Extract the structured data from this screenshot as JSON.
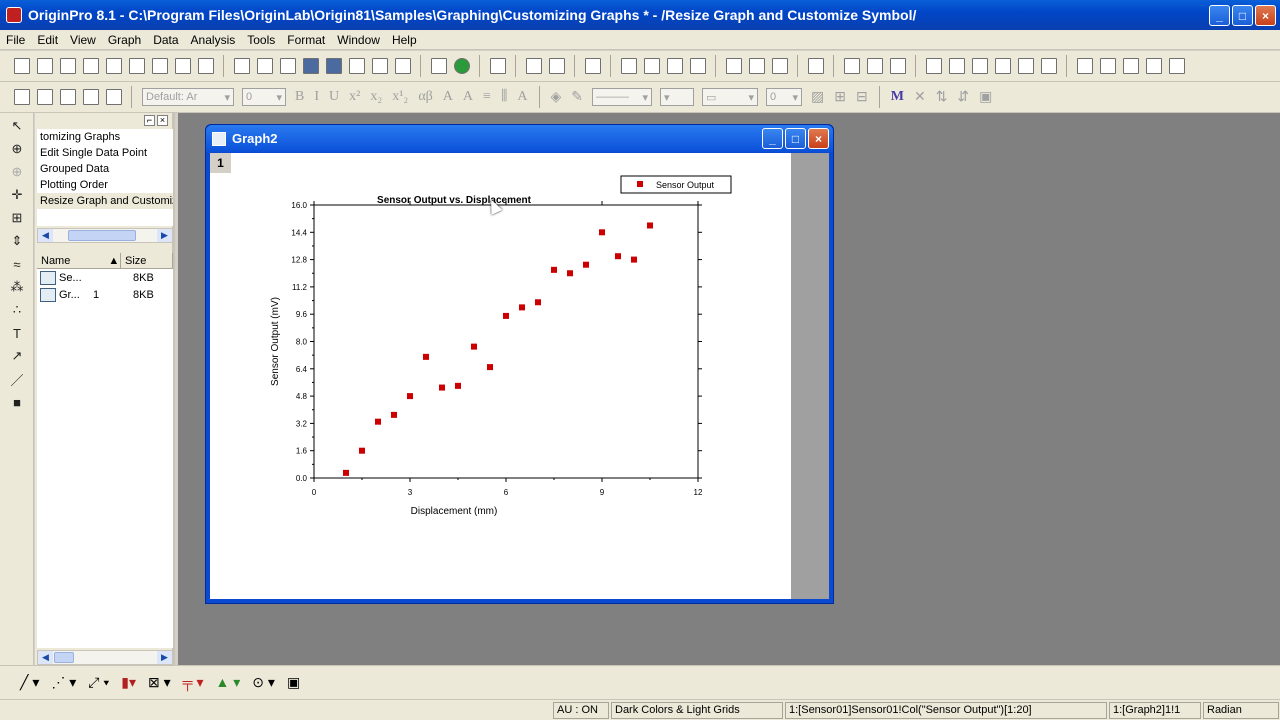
{
  "window": {
    "title": "OriginPro 8.1 - C:\\Program Files\\OriginLab\\Origin81\\Samples\\Graphing\\Customizing Graphs * - /Resize Graph and Customize Symbol/"
  },
  "menu": [
    "File",
    "Edit",
    "View",
    "Graph",
    "Data",
    "Analysis",
    "Tools",
    "Format",
    "Window",
    "Help"
  ],
  "format_toolbar": {
    "font_combo": "Default: Ar",
    "size_combo": "0",
    "extra_combo": "0"
  },
  "explorer": {
    "folders": [
      "tomizing Graphs",
      "Edit Single Data Point",
      "Grouped Data",
      "Plotting Order",
      "Resize Graph and Customiz"
    ],
    "columns": {
      "name": "Name",
      "size": "Size"
    },
    "files": [
      {
        "name": "Se...",
        "extra": "",
        "size": "8KB",
        "icon": "worksheet-icon"
      },
      {
        "name": "Gr...",
        "extra": "1",
        "size": "8KB",
        "icon": "graph-icon"
      }
    ]
  },
  "graph_window": {
    "title": "Graph2",
    "layer": "1"
  },
  "chart_data": {
    "type": "scatter",
    "title": "Sensor Output vs. Displacement",
    "xlabel": "Displacement (mm)",
    "ylabel": "Sensor Output (mV)",
    "xlim": [
      0,
      12
    ],
    "ylim": [
      0,
      16
    ],
    "xticks": [
      "0",
      "3",
      "6",
      "9",
      "12"
    ],
    "yticks": [
      "0.0",
      "1.6",
      "3.2",
      "4.8",
      "6.4",
      "8.0",
      "9.6",
      "11.2",
      "12.8",
      "14.4",
      "16.0"
    ],
    "legend": "Sensor Output",
    "legend_position": "top-right",
    "marker_color": "#cc0000",
    "series": [
      {
        "name": "Sensor Output",
        "x": [
          1.0,
          1.5,
          2.0,
          2.5,
          3.0,
          3.5,
          4.0,
          4.5,
          5.0,
          5.5,
          6.0,
          6.5,
          7.0,
          7.5,
          8.0,
          8.5,
          9.0,
          9.5,
          10.0,
          10.5
        ],
        "y": [
          0.3,
          1.6,
          3.3,
          3.7,
          4.8,
          7.1,
          5.3,
          5.4,
          7.7,
          6.5,
          9.5,
          10.0,
          10.3,
          12.2,
          12.0,
          12.5,
          14.4,
          13.0,
          12.8,
          14.8
        ]
      }
    ]
  },
  "status": {
    "au": "AU : ON",
    "theme": "Dark Colors & Light Grids",
    "source": "1:[Sensor01]Sensor01!Col(\"Sensor Output\")[1:20]",
    "layer": "1:[Graph2]1!1",
    "angle": "Radian"
  }
}
